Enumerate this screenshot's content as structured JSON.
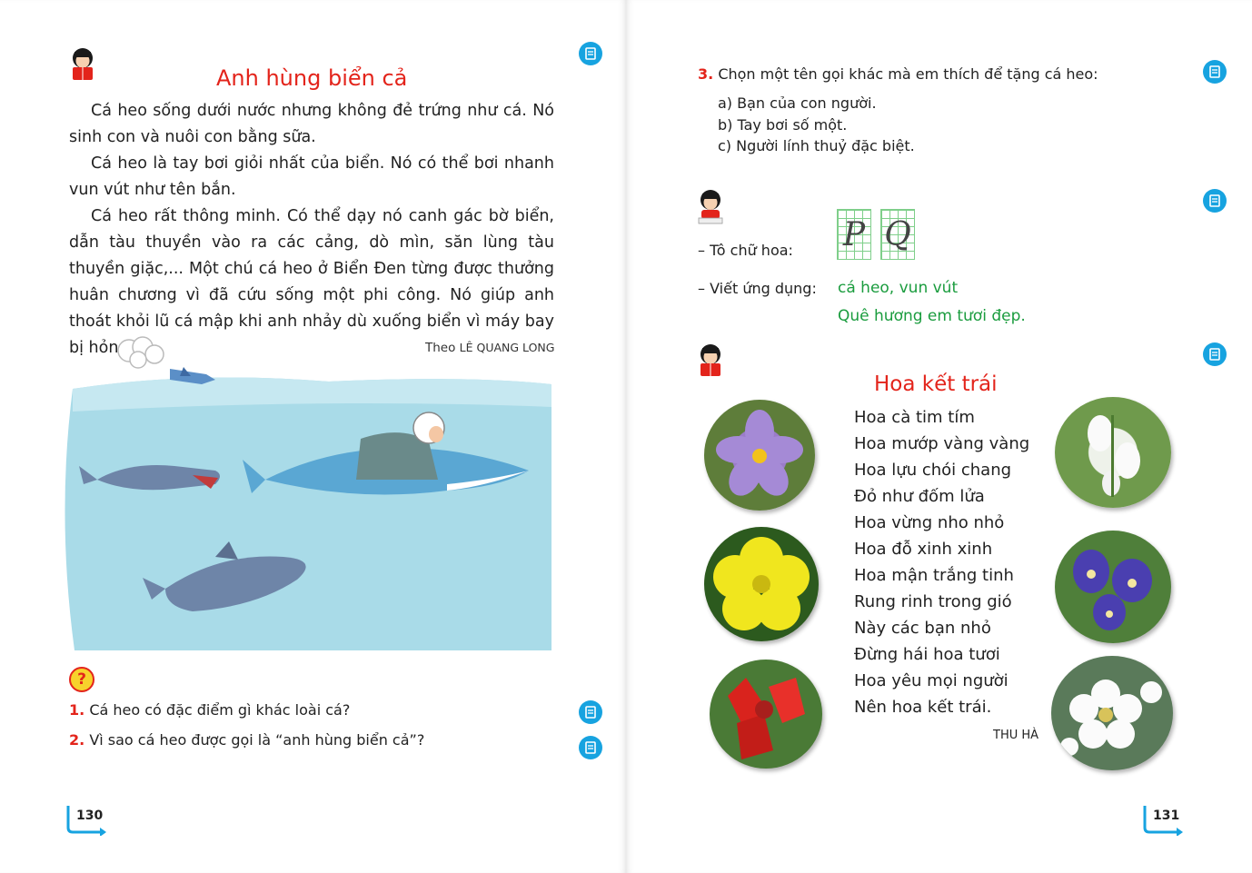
{
  "left_page": {
    "title": "Anh hùng biển cả",
    "paragraphs": [
      "Cá heo sống dưới nước nhưng không đẻ trứng như cá. Nó sinh con và nuôi con bằng sữa.",
      "Cá heo là tay bơi giỏi nhất của biển. Nó có thể bơi nhanh vun vút như tên bắn.",
      "Cá heo rất thông minh. Có thể dạy nó canh gác bờ biển, dẫn tàu thuyền vào ra các cảng, dò mìn, săn lùng tàu thuyền giặc,... Một chú cá heo ở Biển Đen từng được thưởng huân chương vì đã cứu sống một phi công. Nó giúp anh thoát khỏi lũ cá mập khi anh nhảy dù xuống biển vì máy bay bị hỏng."
    ],
    "attribution_prefix": "Theo",
    "attribution_author": "LÊ QUANG LONG",
    "question_icon": "?",
    "questions": [
      {
        "num": "1.",
        "text": "Cá heo có đặc điểm gì khác loài cá?"
      },
      {
        "num": "2.",
        "text": "Vì sao cá heo được gọi là “anh hùng biển cả”?"
      }
    ],
    "page_number": "130"
  },
  "right_page": {
    "q3": {
      "num": "3.",
      "text": "Chọn một tên gọi khác mà em thích để tặng cá heo:"
    },
    "options": [
      "a) Bạn của con người.",
      "b) Tay bơi số một.",
      "c) Người lính thuỷ đặc biệt."
    ],
    "trace_label": "– Tô chữ hoa:",
    "trace_letters": [
      "P",
      "Q"
    ],
    "apply_label": "– Viết ứng dụng:",
    "apply_lines": [
      "cá heo, vun vút",
      "Quê hương em tươi đẹp."
    ],
    "poem_title": "Hoa kết trái",
    "poem_lines": [
      "Hoa cà tim tím",
      "Hoa mướp vàng vàng",
      "Hoa lựu chói chang",
      "Đỏ như đốm lửa",
      "Hoa vừng nho nhỏ",
      "Hoa đỗ xinh xinh",
      "Hoa mận trắng tinh",
      "Rung rinh trong gió",
      "Này các bạn nhỏ",
      "Đừng hái hoa tươi",
      "Hoa yêu mọi người",
      "Nên hoa kết trái."
    ],
    "poem_author": "THU HÀ",
    "page_number": "131"
  },
  "colors": {
    "title_red": "#e3241b",
    "button_blue": "#17a3e0",
    "green_text": "#1a9c3e",
    "sea": "#a9dbe8"
  }
}
